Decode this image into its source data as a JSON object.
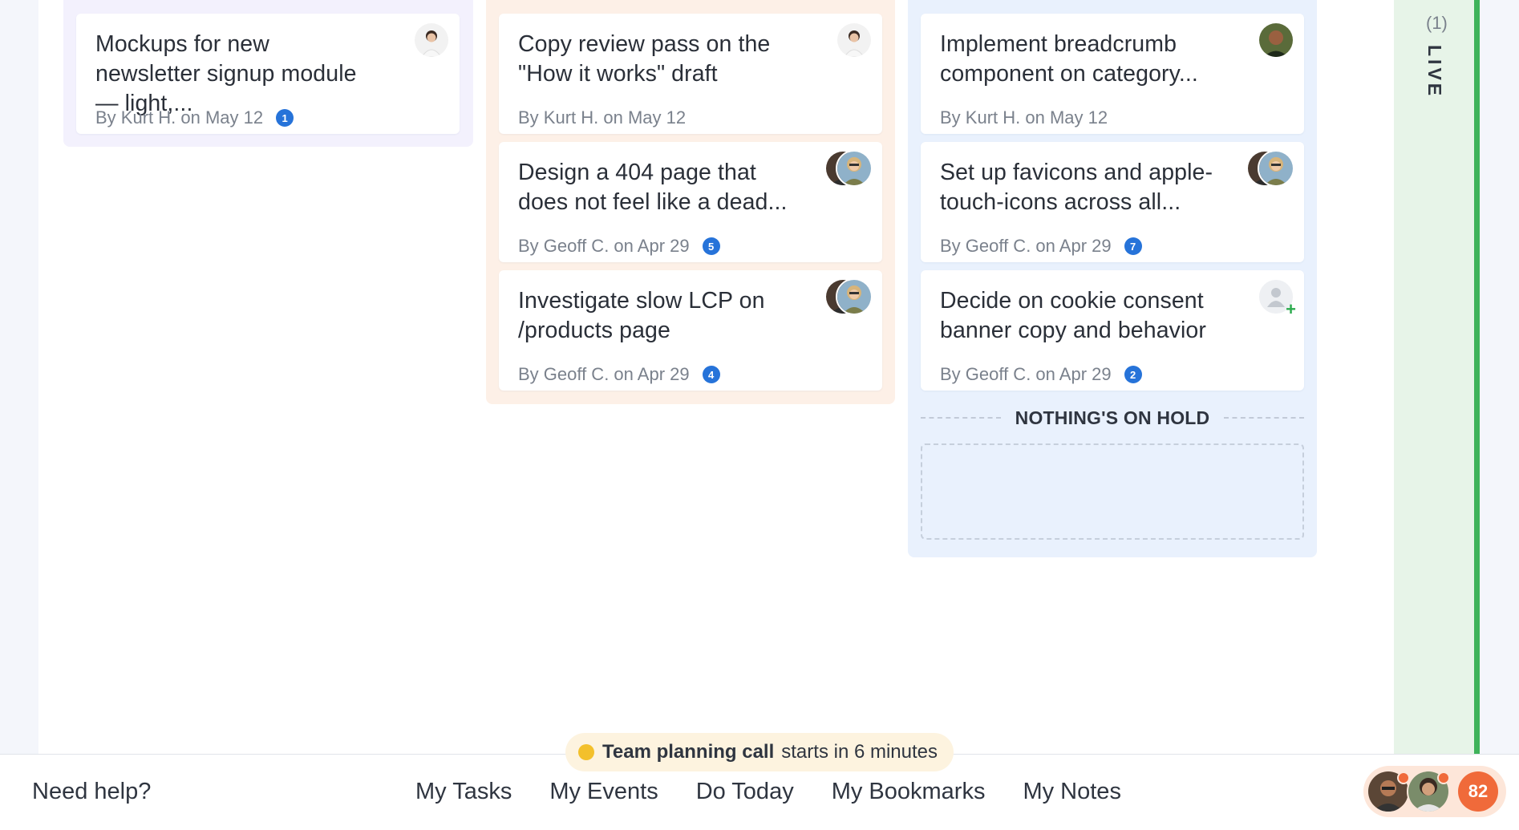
{
  "columns": [
    {
      "cards": [
        {
          "title": "Mockups for new newsletter signup module — light,...",
          "meta": "By Kurt H. on May 12",
          "badge": "1"
        }
      ]
    },
    {
      "cards": [
        {
          "title": "Copy review pass on the \"How it works\" draft",
          "meta": "By Kurt H. on May 12",
          "badge": ""
        },
        {
          "title": "Design a 404 page that does not feel like a dead...",
          "meta": "By Geoff C. on Apr 29",
          "badge": "5"
        },
        {
          "title": "Investigate slow LCP on /products page",
          "meta": "By Geoff C. on Apr 29",
          "badge": "4"
        }
      ]
    },
    {
      "cards": [
        {
          "title": "Implement breadcrumb component on category...",
          "meta": "By Kurt H. on May 12",
          "badge": ""
        },
        {
          "title": "Set up favicons and apple-touch-icons across all...",
          "meta": "By Geoff C. on Apr 29",
          "badge": "7"
        },
        {
          "title": "Decide on cookie consent banner copy and behavior",
          "meta": "By Geoff C. on Apr 29",
          "badge": "2"
        }
      ],
      "on_hold_label": "NOTHING'S ON HOLD"
    }
  ],
  "live": {
    "count": "(1)",
    "label": "LIVE"
  },
  "footer": {
    "help": "Need help?",
    "nav": [
      "My Tasks",
      "My Events",
      "Do Today",
      "My Bookmarks",
      "My Notes"
    ],
    "notification_count": "82"
  },
  "call": {
    "title": "Team planning call",
    "status": "starts in 6 minutes"
  },
  "colors": {
    "accent_blue": "#2673d9",
    "live_green": "#3fb35a",
    "notif_orange": "#f06a3a",
    "call_yellow": "#f3c02b"
  }
}
